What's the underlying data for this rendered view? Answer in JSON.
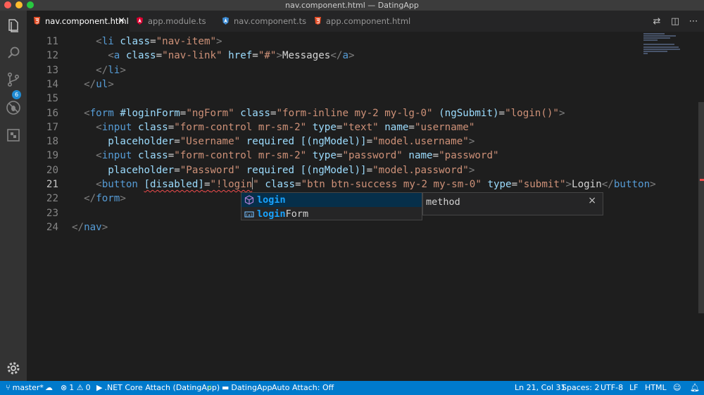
{
  "window": {
    "title": "nav.component.html — DatingApp"
  },
  "activity_bar": {
    "source_control_badge": "6"
  },
  "tabs": [
    {
      "label": "nav.component.html",
      "active": true,
      "icon": "html5-icon"
    },
    {
      "label": "app.module.ts",
      "active": false,
      "icon": "angular-icon"
    },
    {
      "label": "nav.component.ts",
      "active": false,
      "icon": "angular-ts-icon"
    },
    {
      "label": "app.component.html",
      "active": false,
      "icon": "html5-icon"
    }
  ],
  "editor": {
    "current_line": "21",
    "lines": [
      {
        "num": "11",
        "tokens": [
          [
            "tx",
            "    "
          ],
          [
            "p",
            "<"
          ],
          [
            "tg",
            "li"
          ],
          [
            "tx",
            " "
          ],
          [
            "at",
            "class"
          ],
          [
            "tx",
            "="
          ],
          [
            "st",
            "\"nav-item\""
          ],
          [
            "p",
            ">"
          ]
        ]
      },
      {
        "num": "12",
        "tokens": [
          [
            "tx",
            "      "
          ],
          [
            "p",
            "<"
          ],
          [
            "tg",
            "a"
          ],
          [
            "tx",
            " "
          ],
          [
            "at",
            "class"
          ],
          [
            "tx",
            "="
          ],
          [
            "st",
            "\"nav-link\""
          ],
          [
            "tx",
            " "
          ],
          [
            "at",
            "href"
          ],
          [
            "tx",
            "="
          ],
          [
            "st",
            "\"#\""
          ],
          [
            "p",
            ">"
          ],
          [
            "tx",
            "Messages"
          ],
          [
            "p",
            "</"
          ],
          [
            "tg",
            "a"
          ],
          [
            "p",
            ">"
          ]
        ]
      },
      {
        "num": "13",
        "tokens": [
          [
            "tx",
            "    "
          ],
          [
            "p",
            "</"
          ],
          [
            "tg",
            "li"
          ],
          [
            "p",
            ">"
          ]
        ]
      },
      {
        "num": "14",
        "tokens": [
          [
            "tx",
            "  "
          ],
          [
            "p",
            "</"
          ],
          [
            "tg",
            "ul"
          ],
          [
            "p",
            ">"
          ]
        ]
      },
      {
        "num": "15",
        "tokens": []
      },
      {
        "num": "16",
        "tokens": [
          [
            "tx",
            "  "
          ],
          [
            "p",
            "<"
          ],
          [
            "tg",
            "form"
          ],
          [
            "tx",
            " "
          ],
          [
            "at",
            "#loginForm"
          ],
          [
            "tx",
            "="
          ],
          [
            "st",
            "\"ngForm\""
          ],
          [
            "tx",
            " "
          ],
          [
            "at",
            "class"
          ],
          [
            "tx",
            "="
          ],
          [
            "st",
            "\"form-inline my-2 my-lg-0\""
          ],
          [
            "tx",
            " "
          ],
          [
            "at",
            "(ngSubmit)"
          ],
          [
            "tx",
            "="
          ],
          [
            "st",
            "\"login()\""
          ],
          [
            "p",
            ">"
          ]
        ]
      },
      {
        "num": "17",
        "tokens": [
          [
            "tx",
            "    "
          ],
          [
            "p",
            "<"
          ],
          [
            "tg",
            "input"
          ],
          [
            "tx",
            " "
          ],
          [
            "at",
            "class"
          ],
          [
            "tx",
            "="
          ],
          [
            "st",
            "\"form-control mr-sm-2\""
          ],
          [
            "tx",
            " "
          ],
          [
            "at",
            "type"
          ],
          [
            "tx",
            "="
          ],
          [
            "st",
            "\"text\""
          ],
          [
            "tx",
            " "
          ],
          [
            "at",
            "name"
          ],
          [
            "tx",
            "="
          ],
          [
            "st",
            "\"username\""
          ]
        ]
      },
      {
        "num": "18",
        "tokens": [
          [
            "tx",
            "      "
          ],
          [
            "at",
            "placeholder"
          ],
          [
            "tx",
            "="
          ],
          [
            "st",
            "\"Username\""
          ],
          [
            "tx",
            " "
          ],
          [
            "at",
            "required"
          ],
          [
            "tx",
            " "
          ],
          [
            "at",
            "[(ngModel)]"
          ],
          [
            "tx",
            "="
          ],
          [
            "st",
            "\"model.username\""
          ],
          [
            "p",
            ">"
          ]
        ]
      },
      {
        "num": "19",
        "tokens": [
          [
            "tx",
            "    "
          ],
          [
            "p",
            "<"
          ],
          [
            "tg",
            "input"
          ],
          [
            "tx",
            " "
          ],
          [
            "at",
            "class"
          ],
          [
            "tx",
            "="
          ],
          [
            "st",
            "\"form-control mr-sm-2\""
          ],
          [
            "tx",
            " "
          ],
          [
            "at",
            "type"
          ],
          [
            "tx",
            "="
          ],
          [
            "st",
            "\"password\""
          ],
          [
            "tx",
            " "
          ],
          [
            "at",
            "name"
          ],
          [
            "tx",
            "="
          ],
          [
            "st",
            "\"password\""
          ]
        ]
      },
      {
        "num": "20",
        "tokens": [
          [
            "tx",
            "      "
          ],
          [
            "at",
            "placeholder"
          ],
          [
            "tx",
            "="
          ],
          [
            "st",
            "\"Password\""
          ],
          [
            "tx",
            " "
          ],
          [
            "at",
            "required"
          ],
          [
            "tx",
            " "
          ],
          [
            "at",
            "[(ngModel)]"
          ],
          [
            "tx",
            "="
          ],
          [
            "st",
            "\"model.password\""
          ],
          [
            "p",
            ">"
          ]
        ]
      },
      {
        "num": "21",
        "tokens": [
          [
            "tx",
            "    "
          ],
          [
            "p",
            "<"
          ],
          [
            "tg",
            "button"
          ],
          [
            "tx",
            " "
          ],
          [
            "at",
            "[disabled]",
            "sq"
          ],
          [
            "tx",
            "=",
            "sq"
          ],
          [
            "st",
            "\"!login",
            "sq"
          ],
          [
            "cursor",
            ""
          ],
          [
            "st",
            "\""
          ],
          [
            "tx",
            " "
          ],
          [
            "at",
            "class"
          ],
          [
            "tx",
            "="
          ],
          [
            "st",
            "\"btn btn-success my-2 my-sm-0\""
          ],
          [
            "tx",
            " "
          ],
          [
            "at",
            "type"
          ],
          [
            "tx",
            "="
          ],
          [
            "st",
            "\"submit\""
          ],
          [
            "p",
            ">"
          ],
          [
            "tx",
            "Login"
          ],
          [
            "p",
            "</"
          ],
          [
            "tg",
            "button"
          ],
          [
            "p",
            ">"
          ]
        ]
      },
      {
        "num": "22",
        "tokens": [
          [
            "tx",
            "  "
          ],
          [
            "p",
            "</"
          ],
          [
            "tg",
            "form"
          ],
          [
            "p",
            ">"
          ]
        ]
      },
      {
        "num": "23",
        "tokens": []
      },
      {
        "num": "24",
        "tokens": [
          [
            "p",
            "</"
          ],
          [
            "tg",
            "nav"
          ],
          [
            "p",
            ">"
          ]
        ]
      }
    ]
  },
  "suggest": {
    "items": [
      {
        "match": "login",
        "rest": "",
        "icon": "method-cube-icon",
        "selected": true
      },
      {
        "match": "login",
        "rest": "Form",
        "icon": "variable-icon",
        "selected": false
      }
    ],
    "detail": "method",
    "detail_close": "×"
  },
  "status_bar": {
    "branch": "master*",
    "errors": "1",
    "warnings": "0",
    "debug_config": ".NET Core Attach (DatingApp)",
    "folder": "DatingApp",
    "auto_attach": "Auto Attach: Off",
    "position": "Ln 21, Col 31",
    "spaces": "Spaces: 2",
    "encoding": "UTF-8",
    "eol": "LF",
    "language": "HTML"
  },
  "colors": {
    "accent": "#007acc",
    "tag": "#569cd6",
    "attr": "#9cdcfe",
    "string": "#ce9178",
    "error": "#f14c4c"
  }
}
